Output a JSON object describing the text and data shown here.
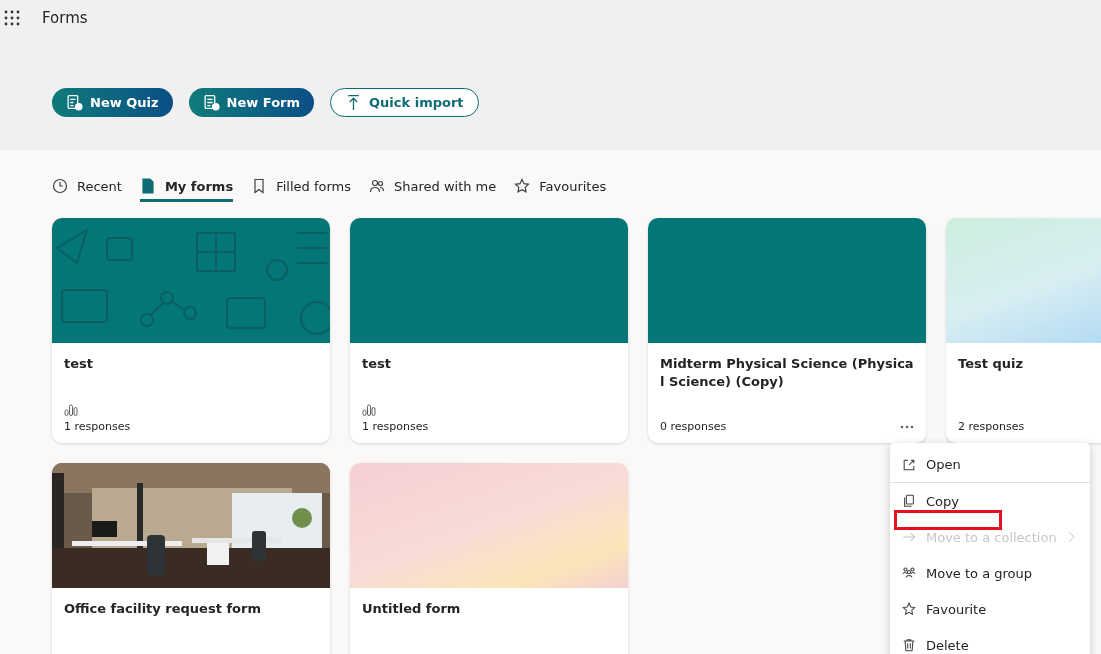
{
  "app": {
    "title": "Forms"
  },
  "actions": [
    {
      "label": "New Quiz",
      "kind": "quiz"
    },
    {
      "label": "New Form",
      "kind": "form"
    },
    {
      "label": "Quick import",
      "kind": "import"
    }
  ],
  "tabs": [
    {
      "label": "Recent",
      "kind": "recent",
      "selected": false
    },
    {
      "label": "My forms",
      "kind": "mine",
      "selected": true
    },
    {
      "label": "Filled forms",
      "kind": "filled",
      "selected": false
    },
    {
      "label": "Shared with me",
      "kind": "shared",
      "selected": false
    },
    {
      "label": "Favourites",
      "kind": "favourites",
      "selected": false
    }
  ],
  "cards": [
    {
      "title": "test",
      "kind": "pattern",
      "stats_icon": true,
      "responses": "1 responses",
      "menu_open": false
    },
    {
      "title": "test",
      "kind": "teal",
      "stats_icon": true,
      "responses": "1 responses",
      "menu_open": false
    },
    {
      "title": "Midterm Physical Science (Physical Science) (Copy)",
      "kind": "teal",
      "stats_icon": false,
      "responses": "0 responses",
      "menu_open": true
    },
    {
      "title": "Test quiz",
      "kind": "mint",
      "stats_icon": false,
      "responses": "2 responses",
      "menu_open": false
    },
    {
      "title": "Office facility request form",
      "kind": "picture",
      "stats_icon": false,
      "menu_open": false
    },
    {
      "title": "Untitled form",
      "kind": "blush",
      "stats_icon": false,
      "menu_open": false
    }
  ],
  "context_menu": [
    {
      "label": "Open",
      "kind": "open",
      "disabled": false,
      "highlighted": false
    },
    {
      "label": "Copy",
      "kind": "copy",
      "disabled": false,
      "highlighted": true
    },
    {
      "label": "Move to a collection",
      "kind": "move",
      "disabled": true,
      "highlighted": false
    },
    {
      "label": "Move to a group",
      "kind": "group",
      "disabled": false,
      "highlighted": false
    },
    {
      "label": "Favourite",
      "kind": "favourite",
      "disabled": false,
      "highlighted": false
    },
    {
      "label": "Delete",
      "kind": "delete",
      "disabled": false,
      "highlighted": false
    }
  ]
}
